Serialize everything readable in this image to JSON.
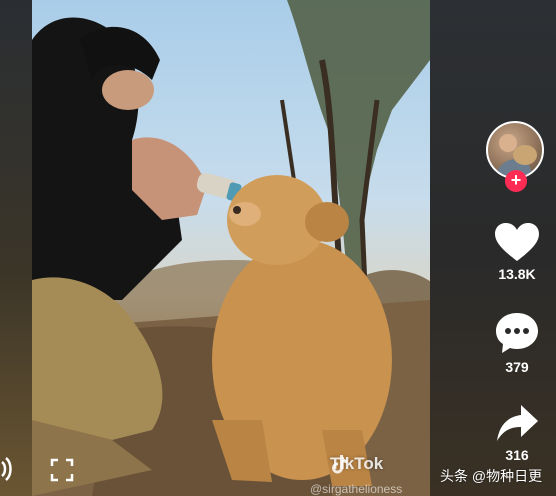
{
  "video": {
    "watermark_brand": "TikTok",
    "creator_handle": "@sirgathelioness"
  },
  "sidebar": {
    "likes_count": "13.8K",
    "comments_count": "379",
    "shares_count": "316"
  },
  "attribution": {
    "text": "头条 @物种日更"
  },
  "colors": {
    "follow_plus": "#fe2c55",
    "icon": "#ffffff"
  },
  "icons": {
    "like": "heart-icon",
    "comment": "comment-bubble-icon",
    "share": "share-arrow-icon",
    "fullscreen": "fullscreen-icon",
    "volume": "volume-icon"
  }
}
